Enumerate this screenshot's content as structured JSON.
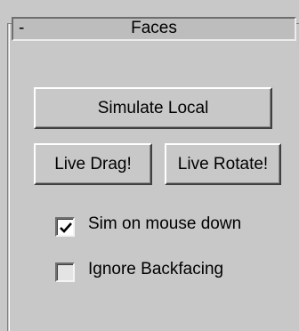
{
  "rollout": {
    "collapse_symbol": "-",
    "title": "Faces"
  },
  "buttons": {
    "simulate_local": "Simulate Local",
    "live_drag": "Live Drag!",
    "live_rotate": "Live Rotate!"
  },
  "options": [
    {
      "label": "Sim on mouse down",
      "checked": true
    },
    {
      "label": "Ignore Backfacing",
      "checked": false
    }
  ],
  "icons": {
    "check": "checkmark-icon"
  }
}
